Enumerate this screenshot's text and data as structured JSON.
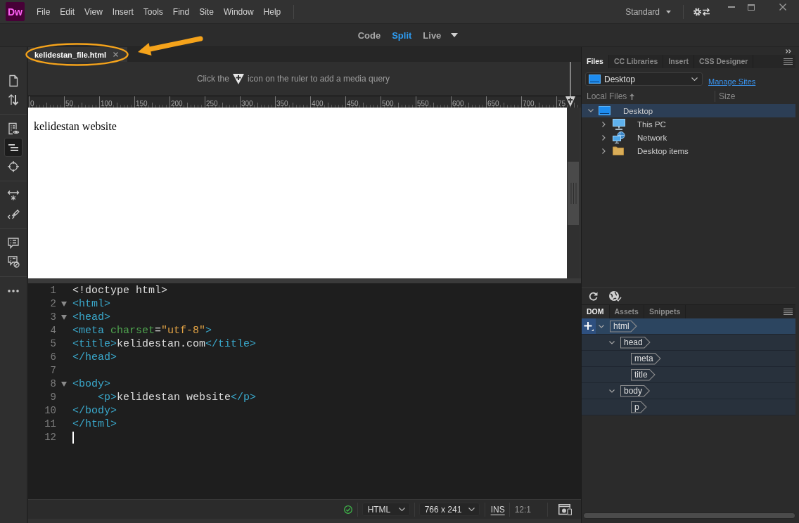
{
  "app": {
    "logo": "Dw"
  },
  "menu_bar": [
    "File",
    "Edit",
    "View",
    "Insert",
    "Tools",
    "Find",
    "Site",
    "Window",
    "Help"
  ],
  "workspace_switcher": {
    "label": "Standard"
  },
  "view_modes": [
    {
      "label": "Code",
      "selected": false
    },
    {
      "label": "Split",
      "selected": true
    },
    {
      "label": "Live",
      "selected": false
    }
  ],
  "left_toolbar": {
    "groups": [
      [
        {
          "kind": "file",
          "selected": false
        },
        {
          "kind": "arrows",
          "selected": false
        }
      ],
      [
        {
          "kind": "document-eye",
          "selected": false
        },
        {
          "kind": "lines",
          "selected": true
        },
        {
          "kind": "crosshair",
          "selected": false
        }
      ],
      [
        {
          "kind": "expand",
          "selected": false
        },
        {
          "kind": "brush",
          "selected": false
        }
      ],
      [
        {
          "kind": "comment",
          "selected": false
        },
        {
          "kind": "comment-off",
          "selected": false
        }
      ],
      [
        {
          "kind": "more",
          "selected": false
        }
      ]
    ]
  },
  "document_tabs": [
    {
      "label": "kelidestan_file.html",
      "selected": true
    }
  ],
  "media_query_bar": {
    "text_before_icon": "Click the",
    "text_after_icon": "icon on the ruler to add a media query"
  },
  "ruler": {
    "labels": [
      "0",
      "50",
      "100",
      "150",
      "200",
      "250",
      "300",
      "350",
      "400",
      "450",
      "500",
      "550",
      "600",
      "650",
      "700",
      "75"
    ]
  },
  "design_view": {
    "paragraph": "kelidestan website"
  },
  "code_view": {
    "lines": [
      {
        "number": "1",
        "fold": false,
        "cursor": false,
        "tokens": [
          {
            "kind": "plain",
            "text": "<!doctype html>"
          }
        ]
      },
      {
        "number": "2",
        "fold": true,
        "cursor": false,
        "tokens": [
          {
            "kind": "tag",
            "text": "<html>"
          }
        ]
      },
      {
        "number": "3",
        "fold": true,
        "cursor": false,
        "tokens": [
          {
            "kind": "tag",
            "text": "<head>"
          }
        ]
      },
      {
        "number": "4",
        "fold": false,
        "cursor": false,
        "tokens": [
          {
            "kind": "tag",
            "text": "<meta"
          },
          {
            "kind": "attr",
            "text": " charset"
          },
          {
            "kind": "plain",
            "text": "="
          },
          {
            "kind": "value",
            "text": "\"utf-8\""
          },
          {
            "kind": "tag",
            "text": ">"
          }
        ]
      },
      {
        "number": "5",
        "fold": false,
        "cursor": false,
        "tokens": [
          {
            "kind": "tag",
            "text": "<title>"
          },
          {
            "kind": "plain",
            "text": "kelidestan.com"
          },
          {
            "kind": "tag",
            "text": "</title>"
          }
        ]
      },
      {
        "number": "6",
        "fold": false,
        "cursor": false,
        "tokens": [
          {
            "kind": "tag",
            "text": "</head>"
          }
        ]
      },
      {
        "number": "7",
        "fold": false,
        "cursor": false
      },
      {
        "number": "8",
        "fold": true,
        "cursor": false,
        "tokens": [
          {
            "kind": "tag",
            "text": "<body>"
          }
        ]
      },
      {
        "number": "9",
        "fold": false,
        "cursor": false,
        "tokens": [
          {
            "kind": "tag",
            "text": "    <p>"
          },
          {
            "kind": "plain",
            "text": "kelidestan website"
          },
          {
            "kind": "tag",
            "text": "</p>"
          }
        ]
      },
      {
        "number": "10",
        "fold": false,
        "cursor": false,
        "tokens": [
          {
            "kind": "tag",
            "text": "</body>"
          }
        ]
      },
      {
        "number": "11",
        "fold": false,
        "cursor": false,
        "tokens": [
          {
            "kind": "tag",
            "text": "</html>"
          }
        ]
      },
      {
        "number": "12",
        "fold": false,
        "cursor": true
      }
    ]
  },
  "status_bar": {
    "language": "HTML",
    "viewport": "766 x 241",
    "mode": "INS",
    "position": "12:1"
  },
  "files_panel": {
    "tabs": [
      {
        "label": "Files",
        "selected": true
      },
      {
        "label": "CC Libraries",
        "selected": false
      },
      {
        "label": "Insert",
        "selected": false
      },
      {
        "label": "CSS Designer",
        "selected": false
      }
    ],
    "site": "Desktop",
    "manage_link": "Manage Sites",
    "columns": [
      "Local Files",
      "Size"
    ],
    "tree": [
      {
        "label": "Desktop",
        "kind": "monitor",
        "expanded": true,
        "selected": true,
        "children": [
          {
            "label": "This PC",
            "kind": "computer",
            "expanded": false,
            "selected": false
          },
          {
            "label": "Network",
            "kind": "network",
            "expanded": false,
            "selected": false
          },
          {
            "label": "Desktop items",
            "kind": "folder",
            "expanded": false,
            "selected": false
          }
        ]
      }
    ]
  },
  "dom_panel": {
    "tabs": [
      {
        "label": "DOM",
        "selected": true
      },
      {
        "label": "Assets",
        "selected": false
      },
      {
        "label": "Snippets",
        "selected": false
      }
    ],
    "tree": [
      {
        "tag": "html",
        "expanded": true,
        "selected": true,
        "children": [
          {
            "tag": "head",
            "expanded": true,
            "selected": false,
            "children": [
              {
                "tag": "meta",
                "selected": false
              },
              {
                "tag": "title",
                "selected": false
              }
            ]
          },
          {
            "tag": "body",
            "expanded": true,
            "selected": false,
            "children": [
              {
                "tag": "p",
                "selected": false
              }
            ]
          }
        ]
      }
    ]
  }
}
